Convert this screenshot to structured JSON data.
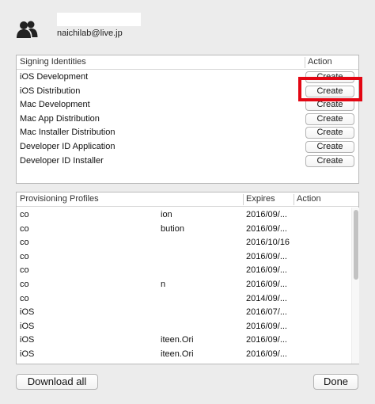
{
  "account": {
    "email": "naichilab@live.jp",
    "avatar_icon": "users-icon"
  },
  "signing": {
    "col_identity": "Signing Identities",
    "col_action": "Action",
    "button_label": "Create",
    "items": [
      {
        "name": "iOS Development"
      },
      {
        "name": "iOS Distribution"
      },
      {
        "name": "Mac Development"
      },
      {
        "name": "Mac App Distribution"
      },
      {
        "name": "Mac Installer Distribution"
      },
      {
        "name": "Developer ID Application"
      },
      {
        "name": "Developer ID Installer"
      }
    ],
    "highlight_color": "#e30613"
  },
  "profiles": {
    "col_name": "Provisioning Profiles",
    "col_expires": "Expires",
    "col_action": "Action",
    "rows": [
      {
        "name": "co",
        "mid": "ion",
        "expires": "2016/09/..."
      },
      {
        "name": "co",
        "mid": "bution",
        "expires": "2016/09/..."
      },
      {
        "name": "co",
        "mid": "",
        "expires": "2016/10/16"
      },
      {
        "name": "co",
        "mid": "",
        "expires": "2016/09/..."
      },
      {
        "name": "co",
        "mid": "",
        "expires": "2016/09/..."
      },
      {
        "name": "co",
        "mid": "n",
        "expires": "2016/09/..."
      },
      {
        "name": "co",
        "mid": "",
        "expires": "2014/09/..."
      },
      {
        "name": "iOS",
        "mid": "",
        "expires": "2016/07/..."
      },
      {
        "name": "iOS",
        "mid": "",
        "expires": "2016/09/..."
      },
      {
        "name": "iOS",
        "mid": "iteen.Ori",
        "expires": "2016/09/..."
      },
      {
        "name": "iOS",
        "mid": "iteen.Ori",
        "expires": "2016/09/..."
      }
    ]
  },
  "footer": {
    "download_label": "Download all",
    "done_label": "Done"
  }
}
